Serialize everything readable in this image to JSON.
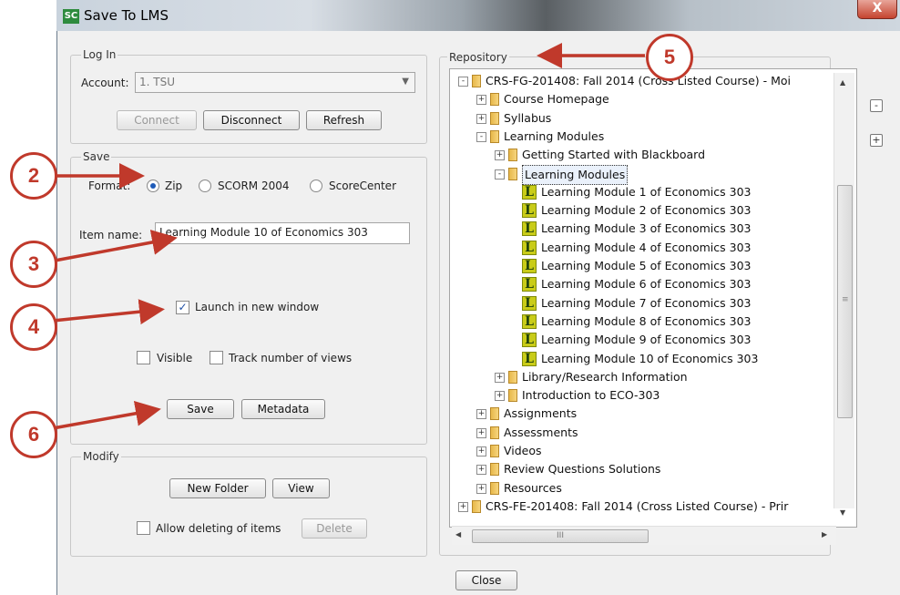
{
  "window": {
    "title": "Save To LMS",
    "icon_text": "SC",
    "close_label": "X"
  },
  "login": {
    "group_label": "Log In",
    "account_label": "Account:",
    "account_value": "1. TSU",
    "connect_label": "Connect",
    "disconnect_label": "Disconnect",
    "refresh_label": "Refresh"
  },
  "save": {
    "group_label": "Save",
    "format_label": "Format:",
    "formats": [
      "Zip",
      "SCORM 2004",
      "ScoreCenter"
    ],
    "selected_format": "Zip",
    "item_name_label": "Item name:",
    "item_name_value": "Learning Module 10 of Economics 303",
    "launch_label": "Launch in new window",
    "launch_checked": true,
    "visible_label": "Visible",
    "track_label": "Track number of views",
    "save_label": "Save",
    "metadata_label": "Metadata"
  },
  "modify": {
    "group_label": "Modify",
    "new_folder_label": "New Folder",
    "view_label": "View",
    "allow_delete_label": "Allow deleting of items",
    "delete_label": "Delete"
  },
  "repository": {
    "group_label": "Repository",
    "collapse_label": "-",
    "expand_label": "+",
    "items": [
      {
        "label": "CRS-FG-201408: Fall 2014 (Cross Listed Course) - Moi",
        "type": "folder",
        "expander": "-"
      },
      {
        "label": "Course Homepage",
        "type": "folder",
        "expander": "+"
      },
      {
        "label": "Syllabus",
        "type": "folder",
        "expander": "+"
      },
      {
        "label": "Learning Modules",
        "type": "folder",
        "expander": "-"
      },
      {
        "label": "Getting Started with Blackboard",
        "type": "folder",
        "expander": "+"
      },
      {
        "label": "Learning Modules",
        "type": "folder",
        "expander": "-"
      },
      {
        "label": "Learning Module 1 of Economics 303",
        "type": "item"
      },
      {
        "label": "Learning Module 2 of Economics 303",
        "type": "item"
      },
      {
        "label": "Learning Module 3 of Economics 303",
        "type": "item"
      },
      {
        "label": "Learning Module 4 of Economics 303",
        "type": "item"
      },
      {
        "label": "Learning Module 5 of Economics 303",
        "type": "item"
      },
      {
        "label": "Learning Module 6 of Economics 303",
        "type": "item"
      },
      {
        "label": "Learning Module 7 of Economics 303",
        "type": "item"
      },
      {
        "label": "Learning Module 8 of Economics 303",
        "type": "item"
      },
      {
        "label": "Learning Module 9 of Economics 303",
        "type": "item"
      },
      {
        "label": "Learning Module 10 of Economics 303",
        "type": "item"
      },
      {
        "label": "Library/Research Information",
        "type": "folder",
        "expander": "+"
      },
      {
        "label": "Introduction to ECO-303",
        "type": "folder",
        "expander": "+"
      },
      {
        "label": "Assignments",
        "type": "folder",
        "expander": "+"
      },
      {
        "label": "Assessments",
        "type": "folder",
        "expander": "+"
      },
      {
        "label": "Videos",
        "type": "folder",
        "expander": "+"
      },
      {
        "label": "Review Questions Solutions",
        "type": "folder",
        "expander": "+"
      },
      {
        "label": "Resources",
        "type": "folder",
        "expander": "+"
      },
      {
        "label": "CRS-FE-201408: Fall 2014 (Cross Listed Course) - Prir",
        "type": "folder",
        "expander": "+"
      }
    ],
    "scroll_h_label": "III"
  },
  "footer": {
    "close_label": "Close"
  },
  "annotations": [
    "2",
    "3",
    "4",
    "5",
    "6"
  ],
  "colors": {
    "annotation": "#c0392b",
    "radio_selected": "#1e5bb8",
    "lms_icon": "#c9cc18"
  }
}
